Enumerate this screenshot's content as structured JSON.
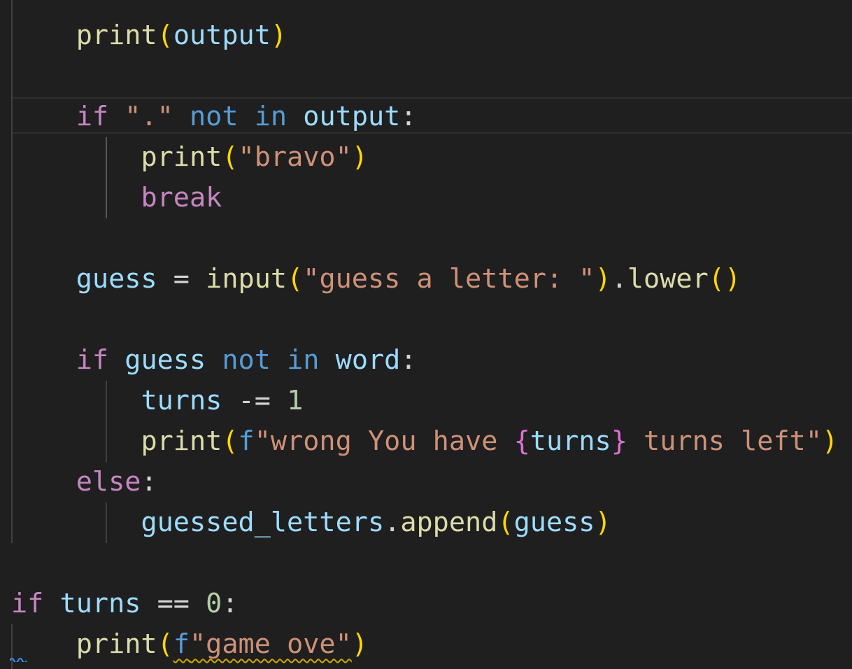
{
  "editor": {
    "language": "python",
    "theme_colors": {
      "background": "#1f1f1f",
      "control_keyword": "#c586c0",
      "keyword": "#569cd6",
      "function": "#dcdcaa",
      "variable": "#9cdcfe",
      "string": "#ce9178",
      "number": "#b5cea8",
      "bracket_level1": "#ffd700",
      "bracket_level2": "#da70d6"
    },
    "lines": [
      {
        "indent": "    ",
        "tokens": [
          [
            "fn",
            "print"
          ],
          [
            "p1",
            "("
          ],
          [
            "var",
            "output"
          ],
          [
            "p1",
            ")"
          ]
        ]
      },
      {
        "indent": "",
        "tokens": []
      },
      {
        "indent": "    ",
        "tokens": [
          [
            "kw-ctrl",
            "if"
          ],
          [
            "op",
            " "
          ],
          [
            "str",
            "\".\""
          ],
          [
            "op",
            " "
          ],
          [
            "kw",
            "not"
          ],
          [
            "op",
            " "
          ],
          [
            "kw",
            "in"
          ],
          [
            "op",
            " "
          ],
          [
            "var",
            "output"
          ],
          [
            "op",
            ":"
          ]
        ]
      },
      {
        "indent": "        ",
        "tokens": [
          [
            "fn",
            "print"
          ],
          [
            "p1",
            "("
          ],
          [
            "str",
            "\"bravo\""
          ],
          [
            "p1",
            ")"
          ]
        ]
      },
      {
        "indent": "        ",
        "tokens": [
          [
            "kw-ctrl",
            "break"
          ]
        ]
      },
      {
        "indent": "",
        "tokens": []
      },
      {
        "indent": "    ",
        "tokens": [
          [
            "var",
            "guess"
          ],
          [
            "op",
            " = "
          ],
          [
            "fn",
            "input"
          ],
          [
            "p1",
            "("
          ],
          [
            "str",
            "\"guess a letter: \""
          ],
          [
            "p1",
            ")"
          ],
          [
            "op",
            "."
          ],
          [
            "fn",
            "lower"
          ],
          [
            "p1",
            "()"
          ]
        ]
      },
      {
        "indent": "",
        "tokens": []
      },
      {
        "indent": "    ",
        "tokens": [
          [
            "kw-ctrl",
            "if"
          ],
          [
            "op",
            " "
          ],
          [
            "var",
            "guess"
          ],
          [
            "op",
            " "
          ],
          [
            "kw",
            "not"
          ],
          [
            "op",
            " "
          ],
          [
            "kw",
            "in"
          ],
          [
            "op",
            " "
          ],
          [
            "var",
            "word"
          ],
          [
            "op",
            ":"
          ]
        ]
      },
      {
        "indent": "        ",
        "tokens": [
          [
            "var",
            "turns"
          ],
          [
            "op",
            " -= "
          ],
          [
            "num",
            "1"
          ]
        ]
      },
      {
        "indent": "        ",
        "tokens": [
          [
            "fn",
            "print"
          ],
          [
            "p1",
            "("
          ],
          [
            "kw",
            "f"
          ],
          [
            "str",
            "\"wrong You have "
          ],
          [
            "p2",
            "{"
          ],
          [
            "var",
            "turns"
          ],
          [
            "p2",
            "}"
          ],
          [
            "str",
            " turns left\""
          ],
          [
            "p1",
            ")"
          ]
        ]
      },
      {
        "indent": "    ",
        "tokens": [
          [
            "kw-ctrl",
            "else"
          ],
          [
            "op",
            ":"
          ]
        ]
      },
      {
        "indent": "        ",
        "tokens": [
          [
            "var",
            "guessed_letters"
          ],
          [
            "op",
            "."
          ],
          [
            "fn",
            "append"
          ],
          [
            "p1",
            "("
          ],
          [
            "var",
            "guess"
          ],
          [
            "p1",
            ")"
          ]
        ]
      },
      {
        "indent": "",
        "tokens": []
      },
      {
        "indent": "",
        "tokens": [
          [
            "kw-ctrl",
            "if"
          ],
          [
            "op",
            " "
          ],
          [
            "var",
            "turns"
          ],
          [
            "op",
            " == "
          ],
          [
            "num",
            "0"
          ],
          [
            "op",
            ":"
          ]
        ]
      },
      {
        "indent": "    ",
        "tokens": [
          [
            "fn",
            "print"
          ],
          [
            "p1",
            "("
          ],
          [
            "kw warn-start",
            "f"
          ],
          [
            "str warn",
            "\"game ove\""
          ],
          [
            "p1",
            ")"
          ]
        ]
      }
    ]
  }
}
